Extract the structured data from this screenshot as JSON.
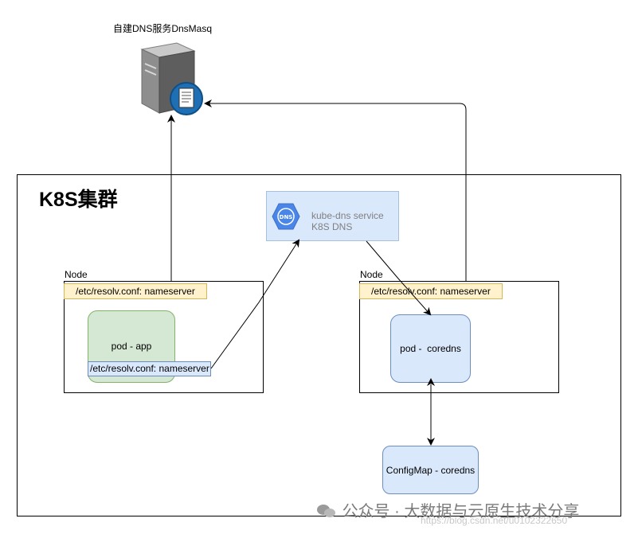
{
  "dns_server": {
    "label": "自建DNS服务DnsMasq"
  },
  "cluster": {
    "title": "K8S集群"
  },
  "service": {
    "line1": "kube-dns service",
    "line2": "K8S DNS",
    "icon_text": "DNS"
  },
  "left_node": {
    "label": "Node",
    "resolv": "/etc/resolv.conf: nameserver",
    "pod": "pod - app",
    "pod_resolv": "/etc/resolv.conf: nameserver"
  },
  "right_node": {
    "label": "Node",
    "resolv": "/etc/resolv.conf: nameserver",
    "pod": "pod -  coredns"
  },
  "configmap": {
    "label": "ConfigMap - coredns"
  },
  "watermark": {
    "text": "公众号 · 大数据与云原生技术分享",
    "url": "https://blog.csdn.net/u0102322650"
  },
  "colors": {
    "green_fill": "#d5e8d4",
    "green_stroke": "#82b366",
    "blue_fill": "#dae8fc",
    "blue_stroke": "#6c8ebf",
    "yellow_fill": "#fff2cc",
    "yellow_stroke": "#d6b656"
  }
}
